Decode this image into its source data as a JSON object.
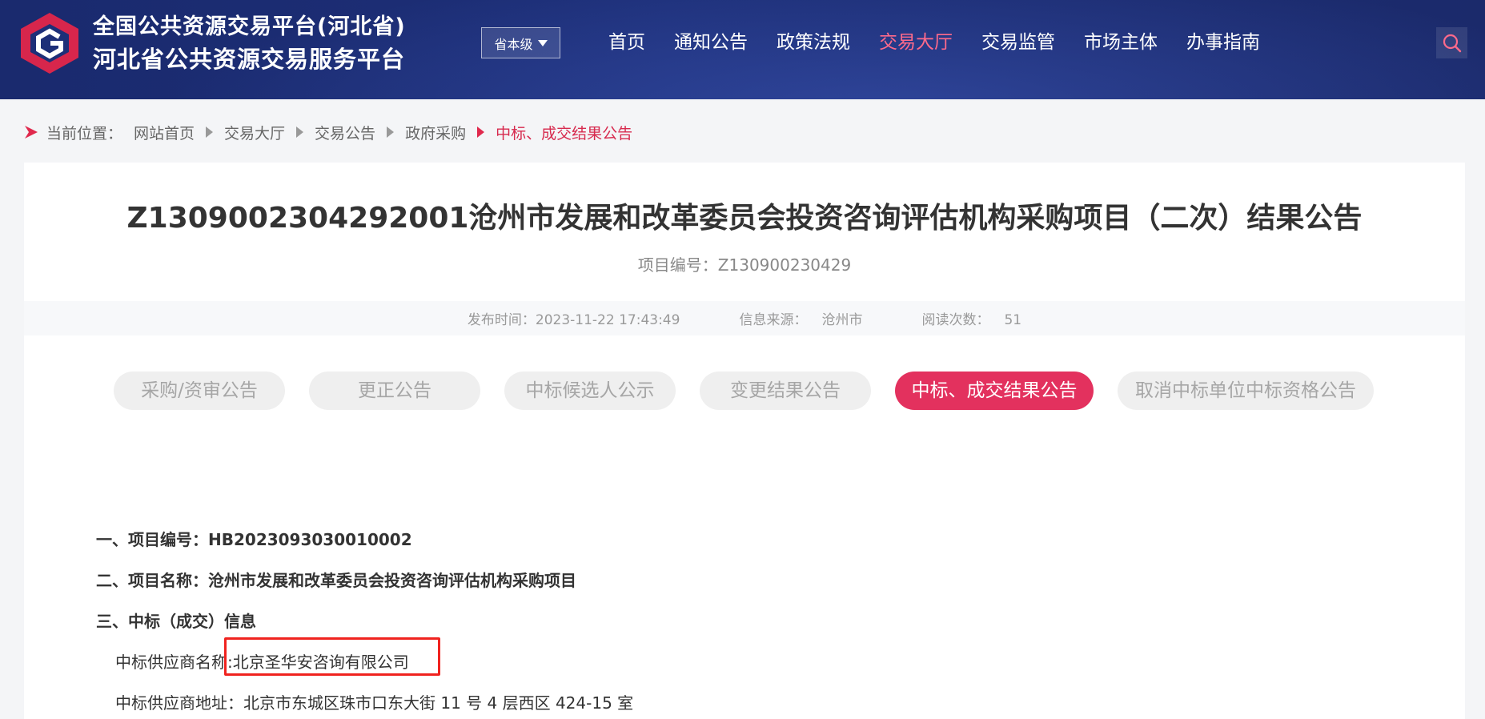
{
  "header": {
    "brand_line1": "全国公共资源交易平台(河北省)",
    "brand_line2": "河北省公共资源交易服务平台",
    "level_select": "省本级",
    "nav": [
      "首页",
      "通知公告",
      "政策法规",
      "交易大厅",
      "交易监管",
      "市场主体",
      "办事指南"
    ],
    "active_nav": "交易大厅",
    "accent_color": "#ff6a8b",
    "bg_color": "#1d2f78",
    "search_icon": "search-icon"
  },
  "breadcrumb": {
    "label": "当前位置：",
    "items": [
      "网站首页",
      "交易大厅",
      "交易公告",
      "政府采购"
    ],
    "current": "中标、成交结果公告"
  },
  "article": {
    "title": "Z1309002304292001沧州市发展和改革委员会投资咨询评估机构采购项目（二次）结果公告",
    "project_no": "项目编号：Z130900230429",
    "meta": {
      "publish_label": "发布时间：",
      "publish_time": "2023-11-22 17:43:49",
      "source_label": "信息来源：",
      "source": "沧州市",
      "reads_label": "阅读次数：",
      "reads": "51"
    },
    "tabs": [
      "采购/资审公告",
      "更正公告",
      "中标候选人公示",
      "变更结果公告",
      "中标、成交结果公告",
      "取消中标单位中标资格公告"
    ],
    "active_tab": "中标、成交结果公告",
    "sections": {
      "s1": "一、项目编号：HB2023093030010002",
      "s2": "二、项目名称：沧州市发展和改革委员会投资咨询评估机构采购项目",
      "s3": "三、中标（成交）信息",
      "supplier_name": "中标供应商名称:北京圣华安咨询有限公司",
      "supplier_address": "中标供应商地址：北京市东城区珠市口东大街 11 号 4 层西区 424-15 室"
    },
    "active_tab_color": "#e3315e",
    "highlight_color": "#f0231f"
  }
}
